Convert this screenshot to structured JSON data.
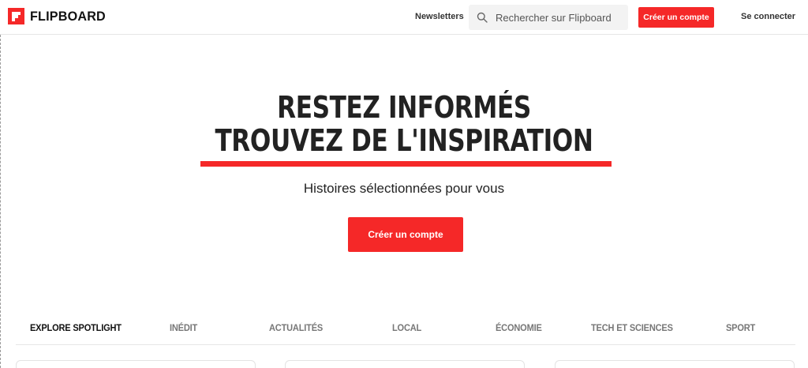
{
  "header": {
    "brand": "FLIPBOARD",
    "newsletters_label": "Newsletters",
    "search_placeholder": "Rechercher sur Flipboard",
    "create_account_label": "Créer un compte",
    "login_label": "Se connecter"
  },
  "hero": {
    "line1": "RESTEZ INFORMÉS",
    "line2": "TROUVEZ DE L'INSPIRATION",
    "subtitle": "Histoires sélectionnées pour vous",
    "cta_label": "Créer un compte"
  },
  "tabs": [
    {
      "label": "EXPLORE SPOTLIGHT",
      "active": true
    },
    {
      "label": "INÉDIT",
      "active": false
    },
    {
      "label": "ACTUALITÉS",
      "active": false
    },
    {
      "label": "LOCAL",
      "active": false
    },
    {
      "label": "ÉCONOMIE",
      "active": false
    },
    {
      "label": "TECH ET SCIENCES",
      "active": false
    },
    {
      "label": "SPORT",
      "active": false
    }
  ],
  "colors": {
    "brand_red": "#f52828",
    "text_dark": "#222222",
    "tab_inactive": "#777777"
  },
  "icons": {
    "logo": "flipboard-logo-icon",
    "search": "search-icon"
  }
}
